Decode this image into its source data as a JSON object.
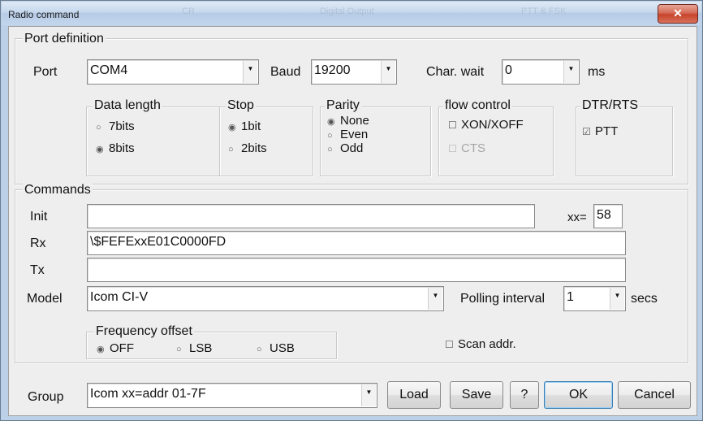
{
  "window": {
    "title": "Radio command",
    "close_glyph": "✕",
    "background_ghost_labels": [
      "CR",
      "Digital Output",
      "PTT & FSK"
    ]
  },
  "port_definition": {
    "group_label": "Port definition",
    "port_label": "Port",
    "port_value": "COM4",
    "baud_label": "Baud",
    "baud_value": "19200",
    "char_wait_label": "Char. wait",
    "char_wait_value": "0",
    "char_wait_unit": "ms",
    "data_length": {
      "label": "Data length",
      "options": [
        {
          "label": "7bits",
          "selected": false
        },
        {
          "label": "8bits",
          "selected": true
        }
      ]
    },
    "stop": {
      "label": "Stop",
      "options": [
        {
          "label": "1bit",
          "selected": true
        },
        {
          "label": "2bits",
          "selected": false
        }
      ]
    },
    "parity": {
      "label": "Parity",
      "options": [
        {
          "label": "None",
          "selected": true
        },
        {
          "label": "Even",
          "selected": false
        },
        {
          "label": "Odd",
          "selected": false
        }
      ]
    },
    "flow_control": {
      "label": "flow control",
      "options": [
        {
          "label": "XON/XOFF",
          "checked": false,
          "enabled": true
        },
        {
          "label": "CTS",
          "checked": false,
          "enabled": false
        }
      ]
    },
    "dtr_rts": {
      "label": "DTR/RTS",
      "options": [
        {
          "label": "PTT",
          "checked": true
        }
      ]
    }
  },
  "commands": {
    "group_label": "Commands",
    "init_label": "Init",
    "init_value": "",
    "xx_label": "xx=",
    "xx_value": "58",
    "rx_label": "Rx",
    "rx_value": "\\$FEFExxE01C0000FD",
    "tx_label": "Tx",
    "tx_value": "",
    "model_label": "Model",
    "model_value": "Icom CI-V",
    "polling_label": "Polling interval",
    "polling_value": "1",
    "polling_unit": "secs",
    "frequency_offset": {
      "label": "Frequency offset",
      "options": [
        {
          "label": "OFF",
          "selected": true
        },
        {
          "label": "LSB",
          "selected": false
        },
        {
          "label": "USB",
          "selected": false
        }
      ]
    },
    "scan_addr": {
      "label": "Scan addr.",
      "checked": false
    }
  },
  "footer": {
    "group_label": "Group",
    "group_value": "Icom  xx=addr 01-7F",
    "load": "Load",
    "save": "Save",
    "help": "?",
    "ok": "OK",
    "cancel": "Cancel"
  },
  "glyphs": {
    "radio_on": "◉",
    "radio_off": "○",
    "check_on": "☑",
    "check_off": "☐",
    "dropdown": "▼"
  },
  "colors": {
    "titlebar": "#c6d8ee",
    "close_button": "#c7432a",
    "dialog_background": "#eeeeee",
    "default_button_border": "#3c7fb1"
  }
}
